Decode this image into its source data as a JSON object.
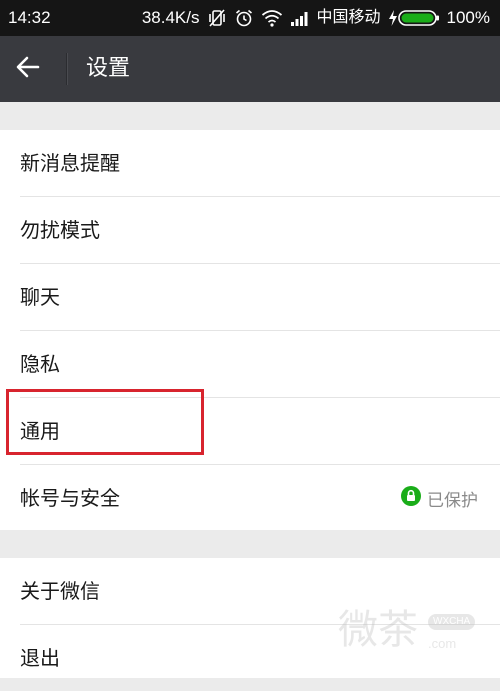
{
  "status_bar": {
    "time": "14:32",
    "net_speed": "38.4K/s",
    "carrier": "中国移动",
    "battery": "100%"
  },
  "header": {
    "title": "设置"
  },
  "settings": {
    "group1": [
      {
        "label": "新消息提醒"
      },
      {
        "label": "勿扰模式"
      },
      {
        "label": "聊天"
      },
      {
        "label": "隐私"
      },
      {
        "label": "通用"
      },
      {
        "label": "帐号与安全",
        "status": "已保护"
      }
    ],
    "group2": [
      {
        "label": "关于微信"
      },
      {
        "label": "退出"
      }
    ]
  },
  "watermark": {
    "text": "微茶",
    "tag": "WXCHA",
    "url": ".com"
  },
  "colors": {
    "action_bar": "#393a3f",
    "status_bar": "#151515",
    "background": "#ebebeb",
    "highlight": "#d8242e",
    "shield_green": "#1aad19"
  },
  "icons": {
    "back": "arrow-left-icon",
    "vibrate": "vibrate-off-icon",
    "alarm": "alarm-icon",
    "wifi": "wifi-icon",
    "signal": "signal-icon",
    "charging": "charging-icon",
    "battery": "battery-icon",
    "lock": "lock-shield-icon"
  }
}
